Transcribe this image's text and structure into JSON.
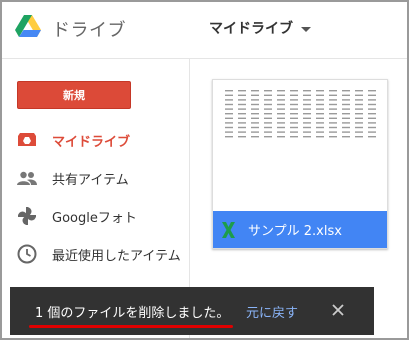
{
  "app": {
    "title": "ドライブ"
  },
  "header": {
    "drive_selector": "マイドライブ"
  },
  "sidebar": {
    "new_button": "新規",
    "items": [
      {
        "label": "マイドライブ",
        "icon": "drive-icon",
        "active": true
      },
      {
        "label": "共有アイテム",
        "icon": "people-icon",
        "active": false
      },
      {
        "label": "Googleフォト",
        "icon": "photos-icon",
        "active": false
      },
      {
        "label": "最近使用したアイテム",
        "icon": "clock-icon",
        "active": false
      }
    ]
  },
  "files": [
    {
      "name": "サンプル 2.xlsx",
      "type_icon": "excel-icon"
    }
  ],
  "toast": {
    "message": "1 個のファイルを削除しました。",
    "undo": "元に戻す",
    "close_icon": "close-icon"
  },
  "colors": {
    "accent_red": "#dc4a38",
    "file_bar_blue": "#4285f4",
    "excel_green": "#1d9d4a",
    "toast_bg": "#323232",
    "underline_red": "#e00000"
  }
}
